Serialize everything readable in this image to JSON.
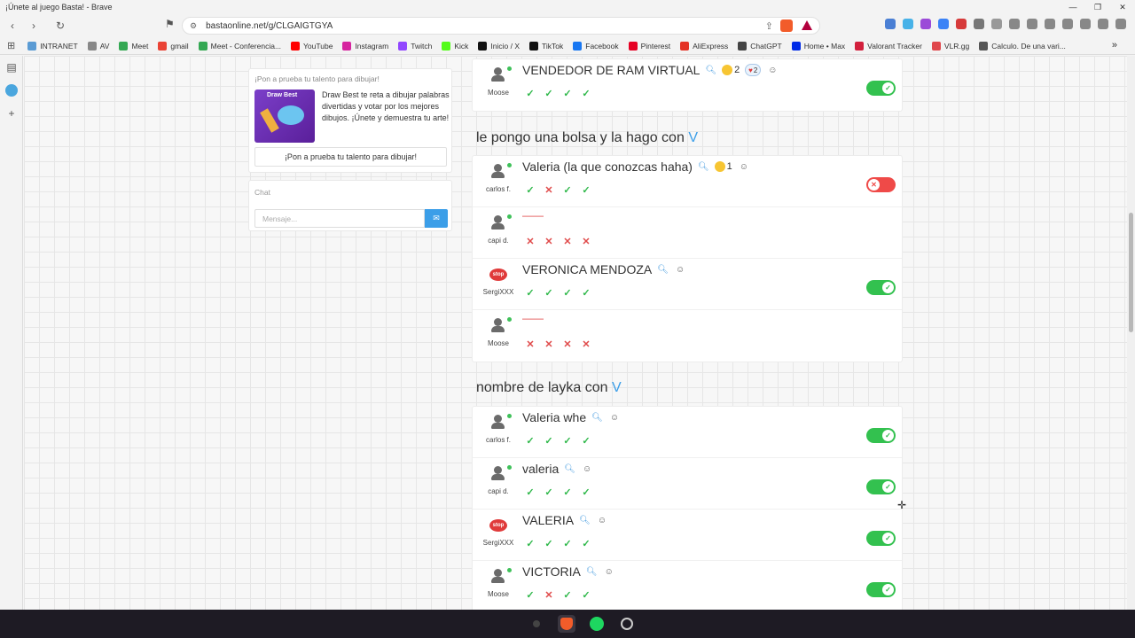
{
  "window": {
    "title": "¡Únete al juego Basta! - Brave"
  },
  "browser": {
    "url": "bastaonline.net/g/CLGAIGTGYA",
    "bookmarks": [
      {
        "label": "INTRANET",
        "color": "#5a9bd4"
      },
      {
        "label": "AV",
        "color": "#888888"
      },
      {
        "label": "Meet",
        "color": "#34a853"
      },
      {
        "label": "gmail",
        "color": "#ea4335"
      },
      {
        "label": "Meet - Conferencia...",
        "color": "#34a853"
      },
      {
        "label": "YouTube",
        "color": "#ff0000"
      },
      {
        "label": "Instagram",
        "color": "#d6249f"
      },
      {
        "label": "Twitch",
        "color": "#9146ff"
      },
      {
        "label": "Kick",
        "color": "#53fc18"
      },
      {
        "label": "Inicio / X",
        "color": "#111111"
      },
      {
        "label": "TikTok",
        "color": "#111111"
      },
      {
        "label": "Facebook",
        "color": "#1877f2"
      },
      {
        "label": "Pinterest",
        "color": "#e60023"
      },
      {
        "label": "AliExpress",
        "color": "#e43225"
      },
      {
        "label": "ChatGPT",
        "color": "#444444"
      },
      {
        "label": "Home • Max",
        "color": "#002be7"
      },
      {
        "label": "Valorant Tracker",
        "color": "#d21f3c"
      },
      {
        "label": "VLR.gg",
        "color": "#e0474c"
      },
      {
        "label": "Calculo. De una vari...",
        "color": "#555555"
      }
    ]
  },
  "promo": {
    "title": "¡Pon a prueba tu talento para dibujar!",
    "image_title": "Draw Best",
    "text": "Draw Best te reta a dibujar palabras divertidas y votar por los mejores dibujos. ¡Únete y demuestra tu arte!",
    "button": "¡Pon a prueba tu talento para dibujar!"
  },
  "chat": {
    "title": "Chat",
    "placeholder": "Mensaje..."
  },
  "categories": [
    {
      "title_prefix": "",
      "letter": "",
      "rows": [
        {
          "player": "Moose",
          "avatar": "person",
          "answer": "VENDEDOR DE RAM VIRTUAL",
          "emoji_count": "2",
          "heart_count": "2",
          "votes": [
            "ok",
            "ok",
            "ok",
            "ok"
          ],
          "accepted": true
        }
      ]
    },
    {
      "title_prefix": "le pongo una bolsa y la hago con",
      "letter": "V",
      "rows": [
        {
          "player": "carlos f.",
          "avatar": "person",
          "answer": "Valeria (la que conozcas haha)",
          "emoji_count": "1",
          "votes": [
            "ok",
            "no",
            "ok",
            "ok"
          ],
          "accepted": false
        },
        {
          "player": "capi d.",
          "avatar": "person",
          "answer": "——",
          "votes": [
            "no",
            "no",
            "no",
            "no"
          ],
          "empty": true
        },
        {
          "player": "SergiXXX",
          "avatar": "stop",
          "answer": "VERONICA MENDOZA",
          "votes": [
            "ok",
            "ok",
            "ok",
            "ok"
          ],
          "accepted": true
        },
        {
          "player": "Moose",
          "avatar": "person",
          "answer": "——",
          "votes": [
            "no",
            "no",
            "no",
            "no"
          ],
          "empty": true
        }
      ]
    },
    {
      "title_prefix": "nombre de layka con",
      "letter": "V",
      "rows": [
        {
          "player": "carlos f.",
          "avatar": "person",
          "answer": "Valeria whe",
          "votes": [
            "ok",
            "ok",
            "ok",
            "ok"
          ],
          "accepted": true
        },
        {
          "player": "capi d.",
          "avatar": "person",
          "answer": "valeria",
          "votes": [
            "ok",
            "ok",
            "ok",
            "ok"
          ],
          "accepted": true
        },
        {
          "player": "SergiXXX",
          "avatar": "stop",
          "answer": "VALERIA",
          "votes": [
            "ok",
            "ok",
            "ok",
            "ok"
          ],
          "accepted": true
        },
        {
          "player": "Moose",
          "avatar": "person",
          "answer": "VICTORIA",
          "votes": [
            "ok",
            "no",
            "ok",
            "ok"
          ],
          "accepted": true
        }
      ]
    }
  ],
  "labels": {
    "stop_badge": "stop",
    "vote_ok": "✓",
    "vote_no": "✕"
  }
}
